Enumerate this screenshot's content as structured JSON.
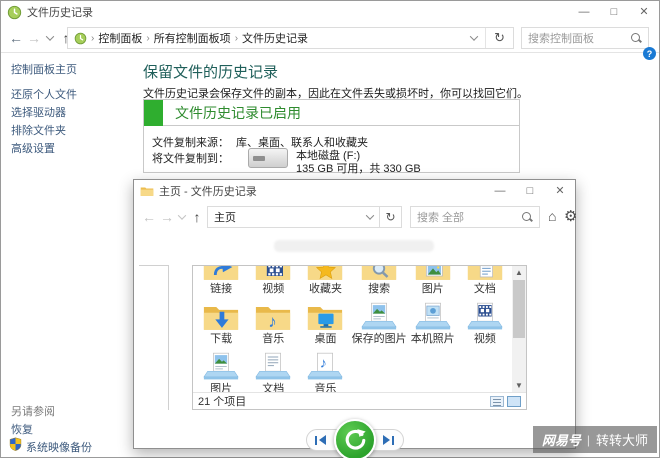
{
  "colors": {
    "green": "#2fae2f",
    "green_dark": "#2e8b2e",
    "teal": "#1f5f5a",
    "link_blue": "#3d5a7d",
    "nav_blue": "#2d6db5",
    "folder_yellow": "#f0c355",
    "restore_green": "#2da32d"
  },
  "window1": {
    "title": "文件历史记录",
    "breadcrumb": [
      "控制面板",
      "所有控制面板项",
      "文件历史记录"
    ],
    "search_placeholder": "搜索控制面板",
    "sidebar": {
      "home": "控制面板主页",
      "items": [
        "还原个人文件",
        "选择驱动器",
        "排除文件夹",
        "高级设置"
      ],
      "see_also_header": "另请参阅",
      "see_also_items": [
        "恢复",
        "系统映像备份"
      ]
    },
    "main": {
      "heading": "保留文件的历史记录",
      "description": "文件历史记录会保存文件的副本，因此在文件丢失或损坏时，你可以找回它们。",
      "status": {
        "title": "文件历史记录已启用",
        "copy_from_label": "文件复制来源：",
        "copy_from_value": "库、桌面、联系人和收藏夹",
        "copy_to_label": "将文件复制到：",
        "drive_name": "本地磁盘 (F:)",
        "drive_space": "135 GB 可用，共 330 GB"
      }
    }
  },
  "window2": {
    "title": "主页 - 文件历史记录",
    "address_value": "主页",
    "search_placeholder": "搜索 全部",
    "items": [
      {
        "label": "链接",
        "kind": "link"
      },
      {
        "label": "视频",
        "kind": "video"
      },
      {
        "label": "收藏夹",
        "kind": "favorites"
      },
      {
        "label": "搜索",
        "kind": "search"
      },
      {
        "label": "图片",
        "kind": "pictures"
      },
      {
        "label": "文档",
        "kind": "documents"
      },
      {
        "label": "下载",
        "kind": "downloads"
      },
      {
        "label": "音乐",
        "kind": "music"
      },
      {
        "label": "桌面",
        "kind": "desktop"
      },
      {
        "label": "保存的图片",
        "kind": "lib-pictures"
      },
      {
        "label": "本机照片",
        "kind": "lib-photos"
      },
      {
        "label": "视频",
        "kind": "lib-videos"
      },
      {
        "label": "图片",
        "kind": "lib-pictures"
      },
      {
        "label": "文档",
        "kind": "lib-documents"
      },
      {
        "label": "音乐",
        "kind": "lib-music"
      }
    ],
    "status_text": "21 个项目"
  },
  "watermark": {
    "brand": "网易号",
    "divider": "|",
    "name": "转转大师"
  }
}
